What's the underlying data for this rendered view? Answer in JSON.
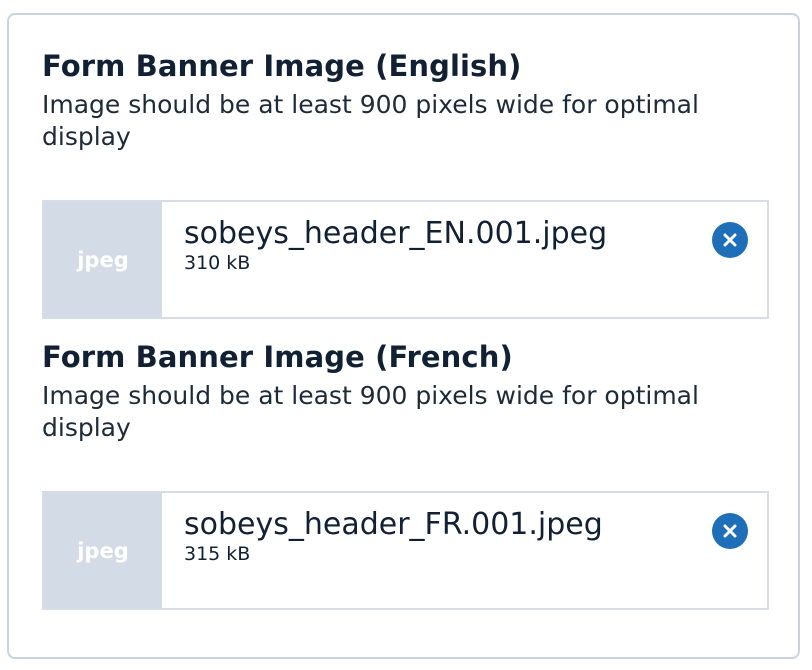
{
  "sections": [
    {
      "title": "Form Banner Image (English)",
      "description": "Image should be at least 900 pixels wide for optimal display",
      "file": {
        "type_label": "jpeg",
        "name": "sobeys_header_EN.001.jpeg",
        "size": "310 kB"
      }
    },
    {
      "title": "Form Banner Image (French)",
      "description": "Image should be at least 900 pixels wide for optimal display",
      "file": {
        "type_label": "jpeg",
        "name": "sobeys_header_FR.001.jpeg",
        "size": "315 kB"
      }
    }
  ],
  "icons": {
    "remove": "close-circle-icon"
  },
  "colors": {
    "accent": "#1f6fb8",
    "file_type_bg": "#d3dce6",
    "border": "#c9d3de",
    "text": "#122033"
  }
}
